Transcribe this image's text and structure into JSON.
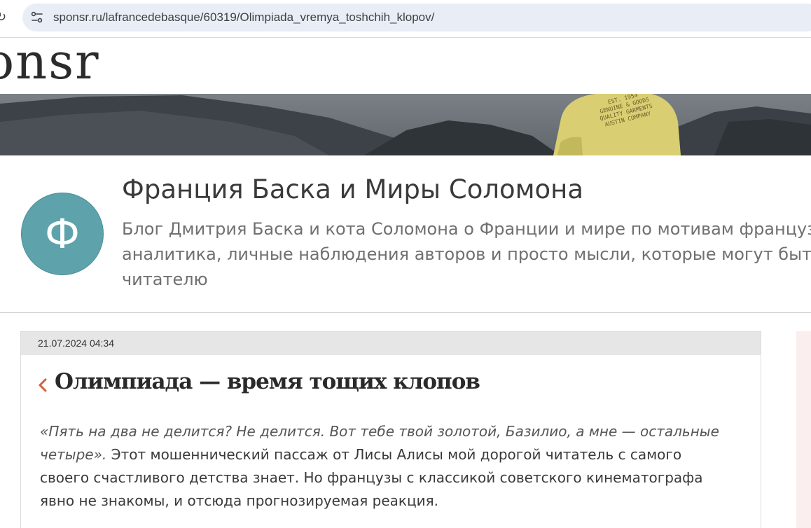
{
  "browser": {
    "url": "sponsr.ru/lafrancedebasque/60319/Olimpiada_vremya_toshchih_klopov/"
  },
  "site": {
    "logo_text": "onsr"
  },
  "blog": {
    "avatar_letter": "Ф",
    "title": "Франция Баска и Миры Соломона",
    "description_lines": [
      "Блог Дмитрия Баска и кота Соломона о Франции и мире по мотивам французс",
      "аналитика, личные наблюдения авторов и просто мысли, которые могут быть",
      "читателю"
    ]
  },
  "post": {
    "date": "21.07.2024 04:34",
    "title": "Олимпиада — время тощих клопов",
    "quote_line1": "«Пять на два не делится? Не делится. Вот тебе твой золотой, Базилио, а мне — остальные",
    "quote_line2": "четыре».",
    "line2_rest": " Этот мошеннический пассаж от Лисы Алисы мой дорогой читатель с самого",
    "line3": "своего счастливого детства знает. Но французы с классикой советского кинематографа",
    "line4": "явно не знакомы, и отсюда прогнозируемая реакция."
  },
  "banner_shirt_text": [
    "EST. 1954",
    "GENUINE & GOODS",
    "QUALITY GARMENTS",
    "AUSTIN COMPANY"
  ],
  "colors": {
    "avatar": "#5ea3ab",
    "accent_back": "#d35f3a",
    "omnibox": "#e9eef6"
  }
}
